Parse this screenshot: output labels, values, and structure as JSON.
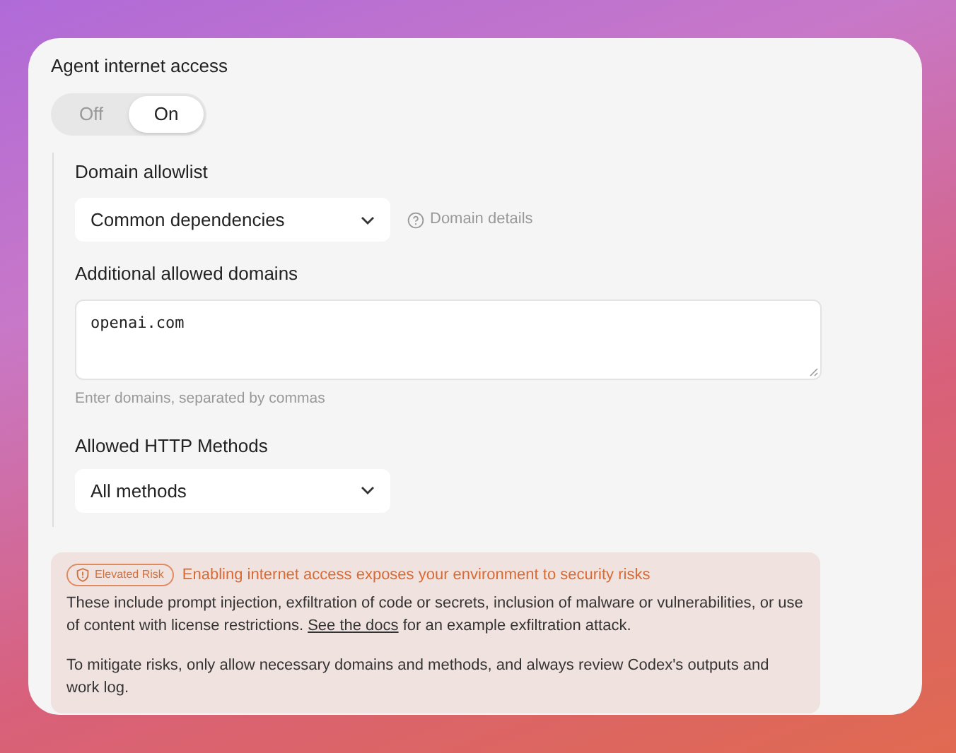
{
  "title": "Agent internet access",
  "toggle": [
    {
      "label": "Off",
      "selected": false
    },
    {
      "label": "On",
      "selected": true
    }
  ],
  "domain_allowlist": {
    "label": "Domain allowlist",
    "value": "Common dependencies",
    "details_link": "Domain details"
  },
  "additional_domains": {
    "label": "Additional allowed domains",
    "value": "openai.com",
    "hint": "Enter domains, separated by commas"
  },
  "http_methods": {
    "label": "Allowed HTTP Methods",
    "value": "All methods"
  },
  "warning": {
    "badge": "Elevated Risk",
    "headline": "Enabling internet access exposes your environment to security risks",
    "text_before": "These include prompt injection, exfiltration of code or secrets, inclusion of malware or vulnerabilities, or use of content with license restrictions. ",
    "link": "See the docs",
    "text_after": " for an example exfiltration attack.",
    "mitigation": "To mitigate risks, only allow necessary domains and methods, and always review Codex's outputs and work log."
  }
}
